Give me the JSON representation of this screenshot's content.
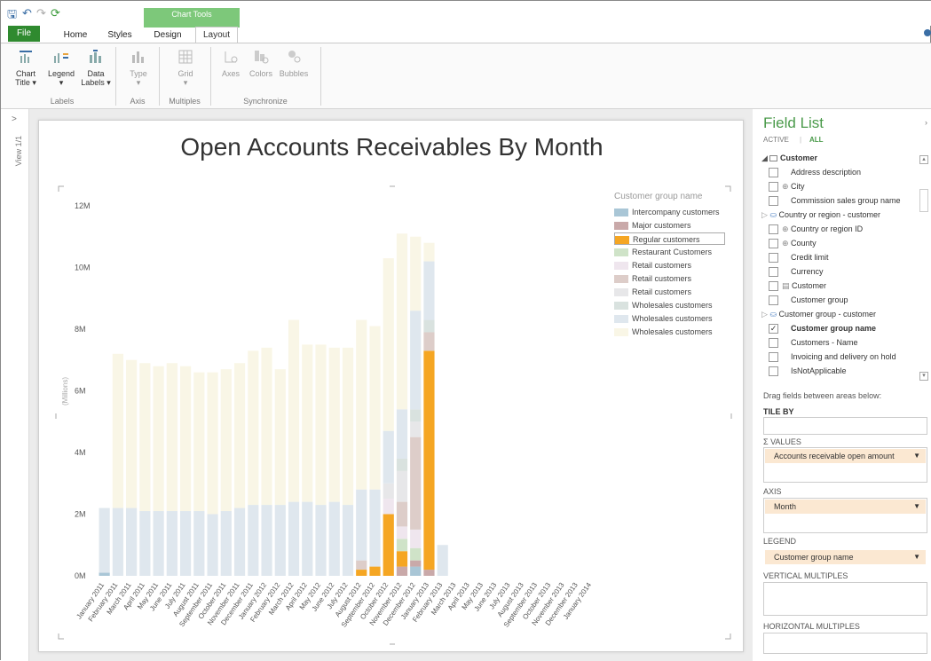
{
  "qat": {
    "save": "🖫",
    "undo": "↶",
    "redo": "↷",
    "refresh": "⟳"
  },
  "context_tab": "Chart Tools",
  "tabs": {
    "file": "File",
    "home": "Home",
    "styles": "Styles",
    "design": "Design",
    "layout": "Layout"
  },
  "ribbon": {
    "chart_title": [
      "Chart",
      "Title ▾"
    ],
    "legend": [
      "Legend",
      "▾"
    ],
    "data_labels": [
      "Data",
      "Labels ▾"
    ],
    "type": [
      "Type",
      "▾"
    ],
    "grid": [
      "Grid",
      "▾"
    ],
    "axes": "Axes",
    "colors": "Colors",
    "bubbles": "Bubbles",
    "groups": {
      "labels": "Labels",
      "axis": "Axis",
      "multiples": "Multiples",
      "synchronize": "Synchronize"
    }
  },
  "view_strip": {
    "arrow": ">",
    "label": "View 1/1"
  },
  "chart_data": {
    "type": "bar",
    "stacked": true,
    "title": "Open Accounts Receivables By Month",
    "ylabel": "(Millions)",
    "ylim": [
      0,
      12000000
    ],
    "yticks": [
      "0M",
      "2M",
      "4M",
      "6M",
      "8M",
      "10M",
      "12M"
    ],
    "legend_title": "Customer group name",
    "legend_position": "right",
    "categories": [
      "January 2011",
      "February 2011",
      "March 2011",
      "April 2011",
      "May 2011",
      "June 2011",
      "July 2011",
      "August 2011",
      "September 2011",
      "October 2011",
      "November 2011",
      "December 2011",
      "January 2012",
      "February 2012",
      "March 2012",
      "April 2012",
      "May 2012",
      "June 2012",
      "July 2012",
      "August 2012",
      "September 2012",
      "October 2012",
      "November 2012",
      "December 2012",
      "January 2013",
      "February 2013",
      "March 2013",
      "April 2013",
      "May 2013",
      "June 2013",
      "July 2013",
      "August 2013",
      "September 2013",
      "October 2013",
      "November 2013",
      "December 2013",
      "January 2014"
    ],
    "series": [
      {
        "name": "Intercompany customers",
        "color": "#a9c6d6",
        "values": [
          0.1,
          0,
          0,
          0,
          0,
          0,
          0,
          0,
          0,
          0,
          0,
          0,
          0,
          0,
          0,
          0,
          0,
          0,
          0,
          0,
          0,
          0,
          0,
          0.3,
          0,
          0,
          0,
          0,
          0,
          0,
          0,
          0,
          0,
          0,
          0,
          0,
          0
        ]
      },
      {
        "name": "Major customers",
        "color": "#c9a9a9",
        "values": [
          0,
          0,
          0,
          0,
          0,
          0,
          0,
          0,
          0,
          0,
          0,
          0,
          0,
          0,
          0,
          0,
          0,
          0,
          0,
          0,
          0,
          0,
          0.3,
          0.2,
          0.2,
          0,
          0,
          0,
          0,
          0,
          0,
          0,
          0,
          0,
          0,
          0,
          0
        ]
      },
      {
        "name": "Regular customers",
        "color": "#f5a623",
        "values": [
          0,
          0,
          0,
          0,
          0,
          0,
          0,
          0,
          0,
          0,
          0,
          0,
          0,
          0,
          0,
          0,
          0,
          0,
          0,
          0.2,
          0.3,
          2.0,
          0.5,
          0,
          7.1,
          0,
          0,
          0,
          0,
          0,
          0,
          0,
          0,
          0,
          0,
          0,
          0
        ]
      },
      {
        "name": "Restaurant Customers",
        "color": "#cfe3c8",
        "values": [
          0,
          0,
          0,
          0,
          0,
          0,
          0,
          0,
          0,
          0,
          0,
          0,
          0,
          0,
          0,
          0,
          0,
          0,
          0,
          0,
          0,
          0,
          0.4,
          0.4,
          0,
          0,
          0,
          0,
          0,
          0,
          0,
          0,
          0,
          0,
          0,
          0,
          0
        ]
      },
      {
        "name": "Retail customers",
        "color": "#efe6ee",
        "values": [
          0,
          0,
          0,
          0,
          0,
          0,
          0,
          0,
          0,
          0,
          0,
          0,
          0,
          0,
          0,
          0,
          0,
          0,
          0,
          0,
          0,
          0.5,
          0.4,
          0.6,
          0,
          0,
          0,
          0,
          0,
          0,
          0,
          0,
          0,
          0,
          0,
          0,
          0
        ]
      },
      {
        "name": "Retail customers",
        "color": "#ddcdc9",
        "values": [
          0,
          0,
          0,
          0,
          0,
          0,
          0,
          0,
          0,
          0,
          0,
          0,
          0,
          0,
          0,
          0,
          0,
          0,
          0,
          0.3,
          0,
          0,
          0.8,
          3.0,
          0.6,
          0,
          0,
          0,
          0,
          0,
          0,
          0,
          0,
          0,
          0,
          0,
          0
        ]
      },
      {
        "name": "Retail customers",
        "color": "#e7e7e9",
        "values": [
          0,
          0,
          0,
          0,
          0,
          0,
          0,
          0,
          0,
          0,
          0,
          0,
          0,
          0,
          0,
          0,
          0,
          0,
          0,
          0,
          0,
          0.5,
          1.0,
          0.5,
          0,
          0,
          0,
          0,
          0,
          0,
          0,
          0,
          0,
          0,
          0,
          0,
          0
        ]
      },
      {
        "name": "Wholesales customers",
        "color": "#d9e2df",
        "values": [
          0,
          0,
          0,
          0,
          0,
          0,
          0,
          0,
          0,
          0,
          0,
          0,
          0,
          0,
          0,
          0,
          0,
          0,
          0,
          0,
          0,
          0,
          0.4,
          0.4,
          0.4,
          0,
          0,
          0,
          0,
          0,
          0,
          0,
          0,
          0,
          0,
          0,
          0
        ]
      },
      {
        "name": "Wholesales customers",
        "color": "#dfe7ee",
        "values": [
          2.1,
          2.2,
          2.2,
          2.1,
          2.1,
          2.1,
          2.1,
          2.1,
          2.0,
          2.1,
          2.2,
          2.3,
          2.3,
          2.3,
          2.4,
          2.4,
          2.3,
          2.4,
          2.3,
          2.3,
          2.5,
          1.7,
          1.6,
          3.2,
          1.9,
          1.0,
          0,
          0,
          0,
          0,
          0,
          0,
          0,
          0,
          0,
          0,
          0
        ]
      },
      {
        "name": "Wholesales customers",
        "color": "#f9f6e6",
        "values": [
          0,
          5.0,
          4.8,
          4.8,
          4.7,
          4.8,
          4.7,
          4.5,
          4.6,
          4.6,
          4.7,
          5.0,
          5.1,
          4.4,
          5.9,
          5.1,
          5.2,
          5.0,
          5.1,
          5.5,
          5.3,
          5.6,
          5.7,
          2.4,
          0.6,
          0,
          0,
          0,
          0,
          0,
          0,
          0,
          0,
          0,
          0,
          0,
          0
        ]
      }
    ]
  },
  "field_list": {
    "title": "Field List",
    "tab_active": "ACTIVE",
    "tab_all": "ALL",
    "table_name": "Customer",
    "fields": [
      {
        "label": "Address description",
        "checked": false,
        "icon": ""
      },
      {
        "label": "City",
        "checked": false,
        "icon": "⊕"
      },
      {
        "label": "Commission sales group name",
        "checked": false,
        "icon": ""
      },
      {
        "label": "Country or region - customer",
        "checked": false,
        "icon": "hier"
      },
      {
        "label": "Country or region ID",
        "checked": false,
        "icon": "⊕"
      },
      {
        "label": "County",
        "checked": false,
        "icon": "⊕"
      },
      {
        "label": "Credit limit",
        "checked": false,
        "icon": ""
      },
      {
        "label": "Currency",
        "checked": false,
        "icon": ""
      },
      {
        "label": "Customer",
        "checked": false,
        "icon": "tbl"
      },
      {
        "label": "Customer group",
        "checked": false,
        "icon": ""
      },
      {
        "label": "Customer group - customer",
        "checked": false,
        "icon": "hier"
      },
      {
        "label": "Customer group name",
        "checked": true,
        "icon": ""
      },
      {
        "label": "Customers - Name",
        "checked": false,
        "icon": ""
      },
      {
        "label": "Invoicing and delivery on hold",
        "checked": false,
        "icon": ""
      },
      {
        "label": "IsNotApplicable",
        "checked": false,
        "icon": ""
      }
    ],
    "drag_hint": "Drag fields between areas below:",
    "tile_by": "TILE BY",
    "values_label": "Σ VALUES",
    "values_field": "Accounts receivable open amount",
    "axis_label": "AXIS",
    "axis_field": "Month",
    "legend_label": "LEGEND",
    "legend_field": "Customer group name",
    "vertical_multiples": "VERTICAL MULTIPLES",
    "horizontal_multiples": "HORIZONTAL MULTIPLES"
  }
}
